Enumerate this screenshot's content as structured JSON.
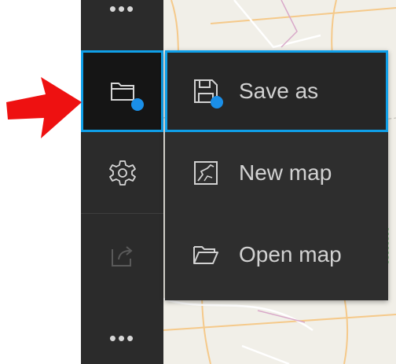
{
  "toolbar": {
    "more_glyph": "•••",
    "items": [
      {
        "name": "open-menu",
        "icon": "folder-icon",
        "active": true,
        "has_notification_dot": true
      },
      {
        "name": "settings",
        "icon": "gear-icon"
      },
      {
        "name": "share",
        "icon": "share-icon",
        "disabled": true
      }
    ]
  },
  "menu": {
    "items": [
      {
        "label": "Save as",
        "icon": "save-icon",
        "highlighted": true,
        "has_notification_dot": true
      },
      {
        "label": "New map",
        "icon": "new-map-icon"
      },
      {
        "label": "Open map",
        "icon": "open-folder-icon"
      }
    ]
  },
  "colors": {
    "toolbar_bg": "#2b2b2b",
    "menu_bg": "#2e2e2e",
    "focus_border": "#0f9fe8",
    "notification_dot": "#1a8fe8",
    "arrow": "#ee1111",
    "text": "#d2d2d2"
  }
}
